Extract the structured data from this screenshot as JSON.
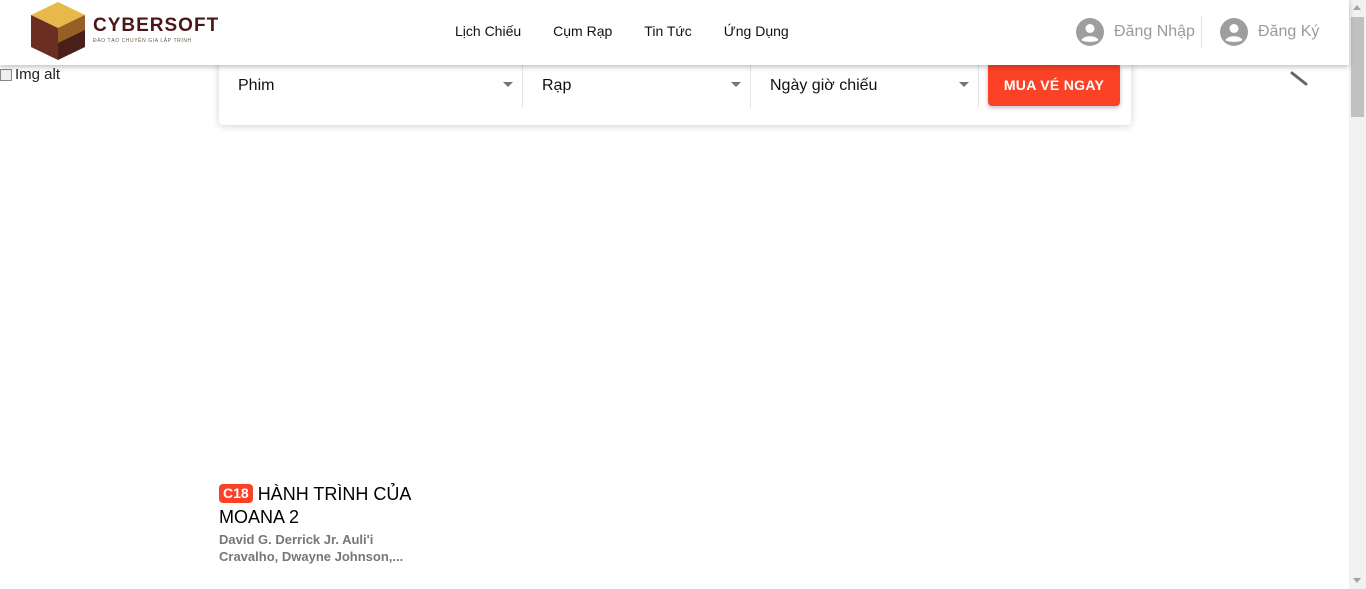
{
  "brand": {
    "name": "CYBERSOFT",
    "tagline": "ĐÀO TẠO CHUYÊN GIA LẬP TRÌNH"
  },
  "nav": {
    "items": [
      "Lịch Chiếu",
      "Cụm Rạp",
      "Tin Tức",
      "Ứng Dụng"
    ]
  },
  "auth": {
    "login": "Đăng Nhập",
    "register": "Đăng Ký",
    "icon": "user-circle-icon"
  },
  "banner": {
    "broken_image_alt": "Img alt"
  },
  "search": {
    "movie_placeholder": "Phim",
    "cinema_placeholder": "Rạp",
    "showtime_placeholder": "Ngày giờ chiếu",
    "buy_button": "MUA VÉ NGAY"
  },
  "movie": {
    "age_rating": "C18",
    "title": "HÀNH TRÌNH CỦA MOANA 2",
    "cast": "David G. Derrick Jr. Auli'i Cravalho, Dwayne Johnson,..."
  },
  "colors": {
    "accent": "#fb4226",
    "brand_dark": "#4a1818",
    "muted_text": "#9b9b9b"
  }
}
